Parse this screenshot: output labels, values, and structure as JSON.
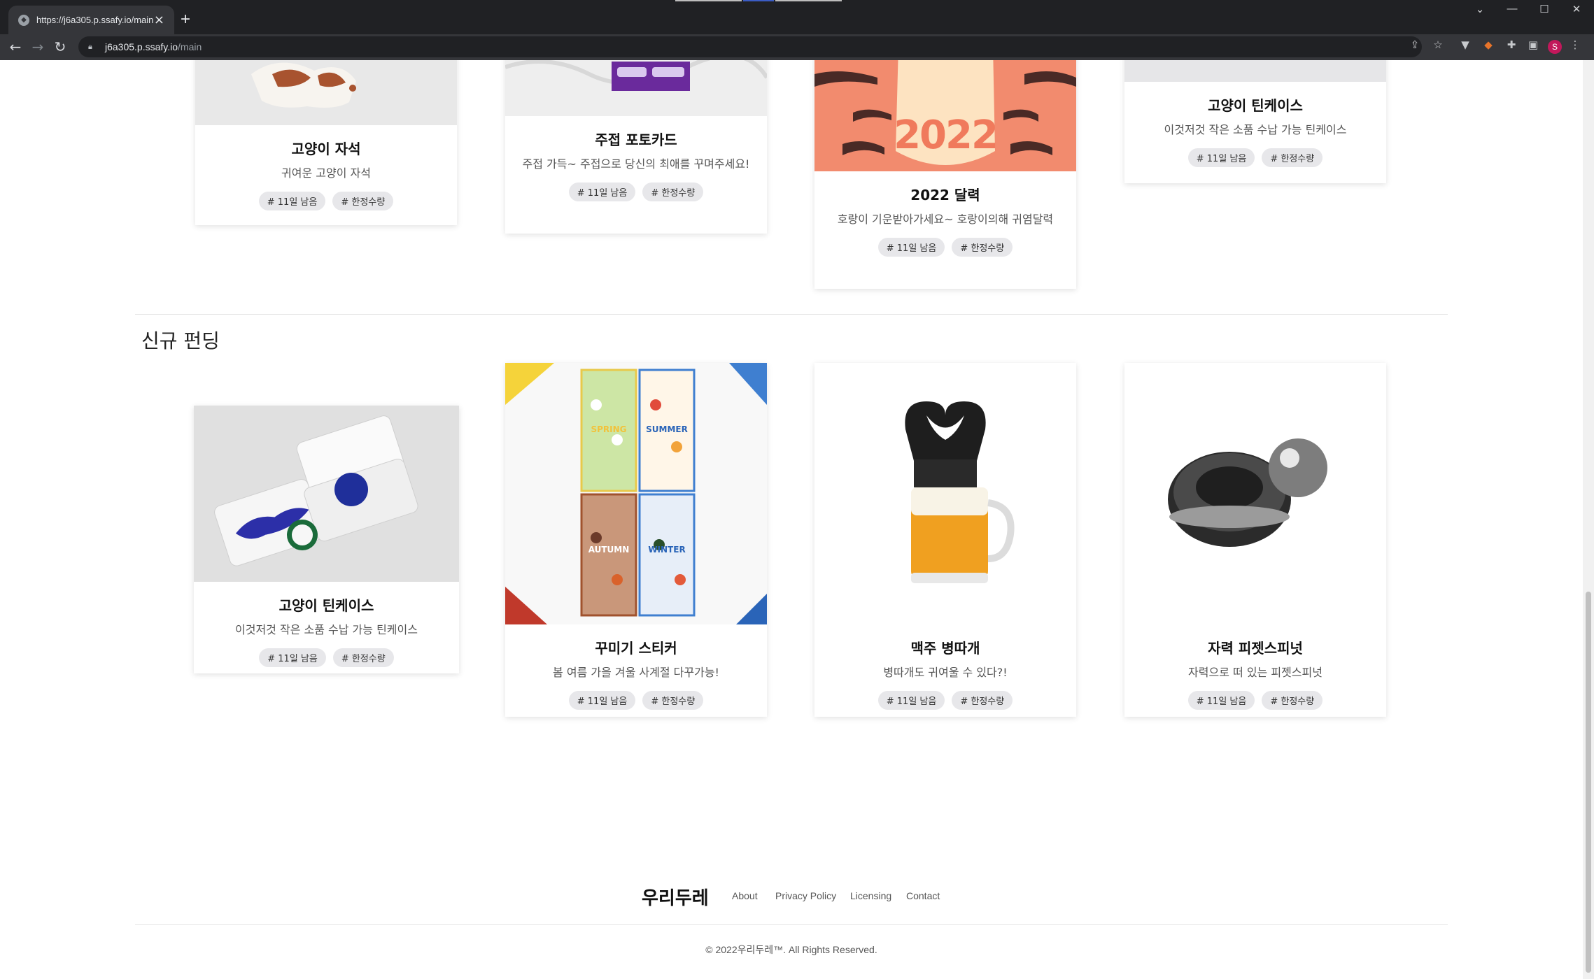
{
  "browser": {
    "tab_title": "https://j6a305.p.ssafy.io/main",
    "url_host": "j6a305.p.ssafy.io",
    "url_path": "/main",
    "profile_initial": "S"
  },
  "top_cards": [
    {
      "title": "고양이 자석",
      "desc": "귀여운 고양이 자석",
      "tags": [
        "# 11일 남음",
        "# 한정수량"
      ]
    },
    {
      "title": "주접 포토카드",
      "desc": "주접 가득~ 주접으로 당신의 최애를 꾸며주세요!",
      "tags": [
        "# 11일 남음",
        "# 한정수량"
      ]
    },
    {
      "title": "2022 달력",
      "desc": "호랑이 기운받아가세요~ 호랑이의해 귀염달력",
      "tags": [
        "# 11일 남음",
        "# 한정수량"
      ],
      "image_text": "2022"
    },
    {
      "title": "고양이 틴케이스",
      "desc": "이것저것 작은 소품 수납 가능 틴케이스",
      "tags": [
        "# 11일 남음",
        "# 한정수량"
      ]
    }
  ],
  "section": {
    "title": "신규 펀딩"
  },
  "new_cards": [
    {
      "title": "고양이 틴케이스",
      "desc": "이것저것 작은 소품 수납 가능 틴케이스",
      "tags": [
        "# 11일 남음",
        "# 한정수량"
      ]
    },
    {
      "title": "꾸미기 스티커",
      "desc": "봄 여름 가을 겨울 사계절 다꾸가능!",
      "tags": [
        "# 11일 남음",
        "# 한정수량"
      ],
      "image_labels": [
        "SPRING",
        "SUMMER",
        "AUTUMN",
        "WINTER"
      ]
    },
    {
      "title": "맥주 병따개",
      "desc": "병따개도 귀여울 수 있다?!",
      "tags": [
        "# 11일 남음",
        "# 한정수량"
      ]
    },
    {
      "title": "자력 피젯스피넛",
      "desc": "자력으로 떠 있는 피젯스피넛",
      "tags": [
        "# 11일 남음",
        "# 한정수량"
      ]
    }
  ],
  "footer": {
    "brand": "우리두레",
    "links": [
      "About",
      "Privacy Policy",
      "Licensing",
      "Contact"
    ],
    "copyright": "© 2022우리두레™. All Rights Reserved."
  },
  "colors": {
    "chrome_dark": "#202124",
    "chrome_toolbar": "#35363a",
    "tag_bg": "#e7e7ea",
    "calendar_bg": "#f28b6e",
    "profile": "#c2185b"
  }
}
